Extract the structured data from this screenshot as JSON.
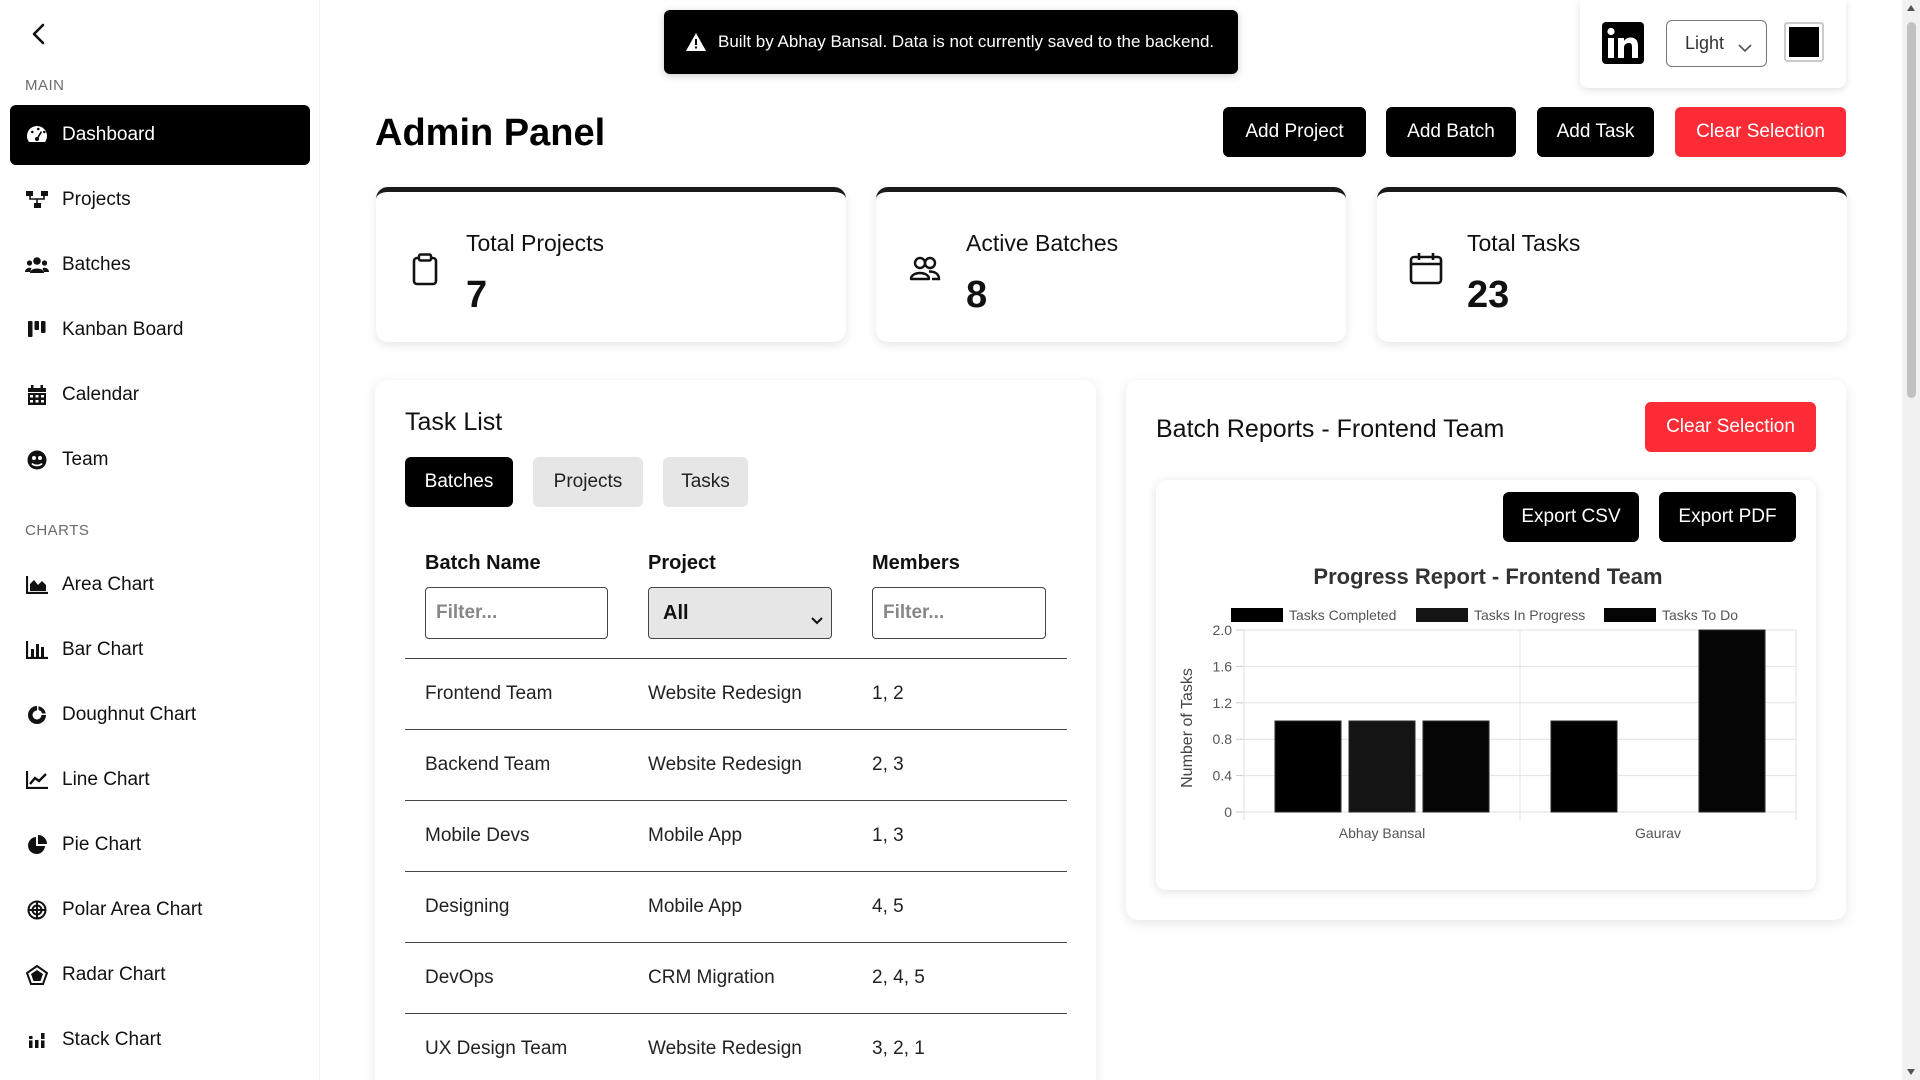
{
  "sidebar": {
    "section_main": "MAIN",
    "section_charts": "CHARTS",
    "main_items": [
      {
        "label": "Dashboard",
        "icon": "dashboard-icon",
        "active": true
      },
      {
        "label": "Projects",
        "icon": "projects-icon"
      },
      {
        "label": "Batches",
        "icon": "users-icon"
      },
      {
        "label": "Kanban Board",
        "icon": "kanban-icon"
      },
      {
        "label": "Calendar",
        "icon": "calendar-icon"
      },
      {
        "label": "Team",
        "icon": "team-icon"
      }
    ],
    "chart_items": [
      {
        "label": "Area Chart",
        "icon": "area-chart-icon"
      },
      {
        "label": "Bar Chart",
        "icon": "bar-chart-icon"
      },
      {
        "label": "Doughnut Chart",
        "icon": "doughnut-chart-icon"
      },
      {
        "label": "Line Chart",
        "icon": "line-chart-icon"
      },
      {
        "label": "Pie Chart",
        "icon": "pie-chart-icon"
      },
      {
        "label": "Polar Area Chart",
        "icon": "polar-area-chart-icon"
      },
      {
        "label": "Radar Chart",
        "icon": "radar-chart-icon"
      },
      {
        "label": "Stack Chart",
        "icon": "stack-chart-icon"
      }
    ]
  },
  "toast": {
    "message": "Built by Abhay Bansal. Data is not currently saved to the backend."
  },
  "topbar": {
    "theme": "Light",
    "accent_color": "#000000"
  },
  "header": {
    "title": "Admin Panel",
    "buttons": {
      "add_project": "Add Project",
      "add_batch": "Add Batch",
      "add_task": "Add Task",
      "clear_selection": "Clear Selection"
    }
  },
  "stats": [
    {
      "label": "Total Projects",
      "value": "7",
      "icon": "clipboard-icon"
    },
    {
      "label": "Active Batches",
      "value": "8",
      "icon": "users-outline-icon"
    },
    {
      "label": "Total Tasks",
      "value": "23",
      "icon": "calendar-outline-icon"
    }
  ],
  "task_list": {
    "title": "Task List",
    "tabs": [
      "Batches",
      "Projects",
      "Tasks"
    ],
    "active_tab": "Batches",
    "columns": [
      "Batch Name",
      "Project",
      "Members"
    ],
    "filters": {
      "batch_placeholder": "Filter...",
      "project_value": "All",
      "members_placeholder": "Filter..."
    },
    "rows": [
      {
        "name": "Frontend Team",
        "project": "Website Redesign",
        "members": "1, 2"
      },
      {
        "name": "Backend Team",
        "project": "Website Redesign",
        "members": "2, 3"
      },
      {
        "name": "Mobile Devs",
        "project": "Mobile App",
        "members": "1, 3"
      },
      {
        "name": "Designing",
        "project": "Mobile App",
        "members": "4, 5"
      },
      {
        "name": "DevOps",
        "project": "CRM Migration",
        "members": "2, 4, 5"
      },
      {
        "name": "UX Design Team",
        "project": "Website Redesign",
        "members": "3, 2, 1"
      }
    ]
  },
  "reports": {
    "title": "Batch Reports - Frontend Team",
    "clear_selection": "Clear Selection",
    "export_csv": "Export CSV",
    "export_pdf": "Export PDF"
  },
  "colors": {
    "primary": "#000000",
    "danger": "#fb2c36"
  },
  "chart_data": {
    "type": "bar",
    "title": "Progress Report - Frontend Team",
    "xlabel": "",
    "ylabel": "Number of Tasks",
    "categories": [
      "Abhay Bansal",
      "Gaurav"
    ],
    "series": [
      {
        "name": "Tasks Completed",
        "values": [
          1,
          1
        ],
        "color": "#000000"
      },
      {
        "name": "Tasks In Progress",
        "values": [
          1,
          0
        ],
        "color": "#141414"
      },
      {
        "name": "Tasks To Do",
        "values": [
          1,
          2
        ],
        "color": "#050505"
      }
    ],
    "ylim": [
      0,
      2
    ],
    "yticks": [
      "0",
      "0.4",
      "0.8",
      "1.2",
      "1.6",
      "2.0"
    ],
    "legend": "top",
    "grid": true
  }
}
